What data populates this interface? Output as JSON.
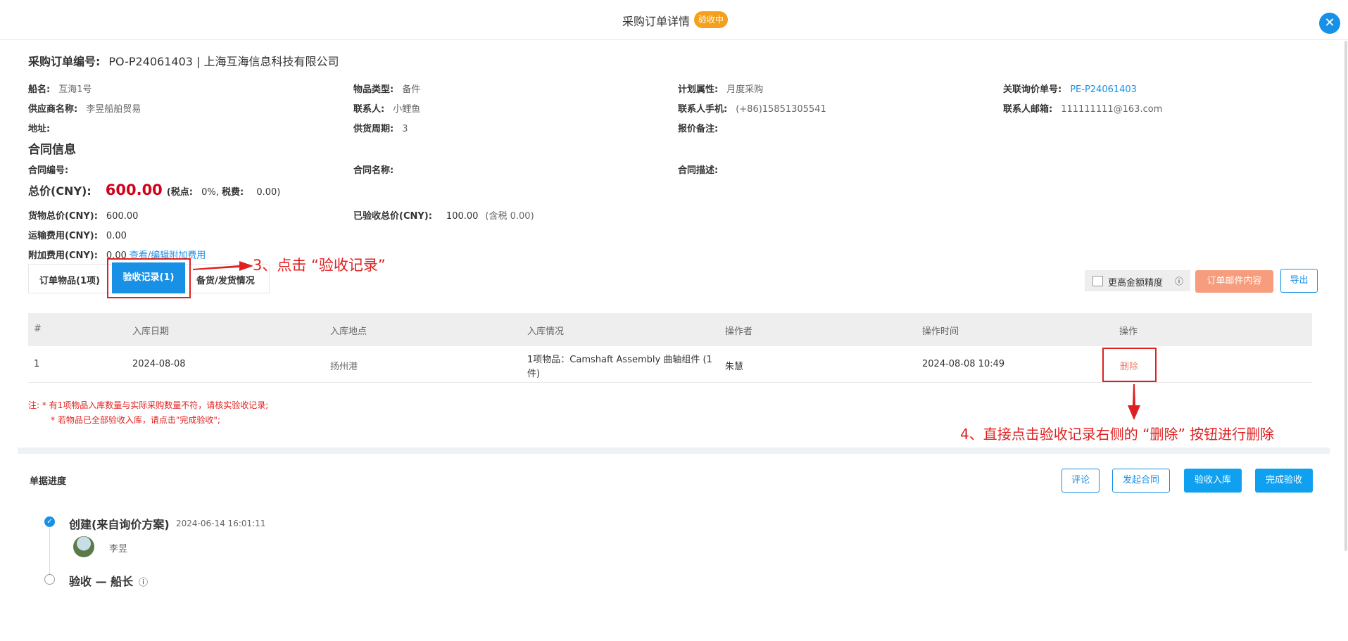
{
  "header": {
    "title": "采购订单详情",
    "status_badge": "验收中",
    "close_icon": "close-icon"
  },
  "order": {
    "number_label": "采购订单编号:",
    "number_value": "PO-P24061403 | 上海互海信息科技有限公司"
  },
  "info": {
    "ship_label": "船名:",
    "ship_value": "互海1号",
    "item_type_label": "物品类型:",
    "item_type_value": "备件",
    "plan_label": "计划属性:",
    "plan_value": "月度采购",
    "inquiry_label": "关联询价单号:",
    "inquiry_value": "PE-P24061403",
    "supplier_label": "供应商名称:",
    "supplier_value": "李昱船舶贸易",
    "contact_label": "联系人:",
    "contact_value": "小鲤鱼",
    "phone_label": "联系人手机:",
    "phone_value": "(+86)15851305541",
    "email_label": "联系人邮箱:",
    "email_value": "111111111@163.com",
    "address_label": "地址:",
    "supply_cycle_label": "供货周期:",
    "supply_cycle_value": "3",
    "quote_note_label": "报价备注:"
  },
  "contract": {
    "section_title": "合同信息",
    "number_label": "合同编号:",
    "name_label": "合同名称:",
    "desc_label": "合同描述:"
  },
  "totals": {
    "total_label": "总价(CNY):",
    "total_value": "600.00",
    "tax_open": "(税点:",
    "tax_rate": "0%,",
    "tax_fee_label": "税费:",
    "tax_fee_value": "0.00)",
    "goods_label": "货物总价(CNY):",
    "goods_value": "600.00",
    "accepted_label": "已验收总价(CNY):",
    "accepted_value": "100.00",
    "accepted_tax": "(含税 0.00)",
    "shipping_label": "运输费用(CNY):",
    "shipping_value": "0.00",
    "extra_label": "附加费用(CNY):",
    "extra_value": "0.00",
    "extra_link": "查看/编辑附加费用"
  },
  "tabs": {
    "items": "订单物品(1项)",
    "records": "验收记录(1)",
    "shipping": "备货/发货情况"
  },
  "toolbar": {
    "precision": "更高金额精度",
    "info_icon": "ⓘ",
    "mail": "订单邮件内容",
    "export": "导出"
  },
  "table": {
    "headers": [
      "#",
      "入库日期",
      "入库地点",
      "入库情况",
      "操作者",
      "操作时间",
      "操作"
    ],
    "row": {
      "idx": "1",
      "date": "2024-08-08",
      "place": "扬州港",
      "status_line1": "1项物品：Camshaft Assembly 曲轴组件 (1",
      "status_line2": "件)",
      "operator": "朱慧",
      "time": "2024-08-08 10:49",
      "action": "删除"
    }
  },
  "notes": {
    "line1": "注:   *  有1项物品入库数量与实际采购数量不符，请核实验收记录;",
    "line2": "*  若物品已全部验收入库，请点击\"完成验收\";"
  },
  "annotations": {
    "step3": "3、点击 “验收记录”",
    "step4": "4、直接点击验收记录右侧的 “删除” 按钮进行删除"
  },
  "progress": {
    "title": "单据进度",
    "buttons": {
      "comment": "评论",
      "contract": "发起合同",
      "stock_in": "验收入库",
      "complete": "完成验收"
    },
    "step1_title": "创建(来自询价方案)",
    "step1_time": "2024-06-14 16:01:11",
    "step1_user": "李昱",
    "step2_title": "验收 — 船长"
  },
  "colors": {
    "accent": "#1890e6",
    "badge": "#f4a01c",
    "danger": "#e02020",
    "price": "#d0021b"
  }
}
